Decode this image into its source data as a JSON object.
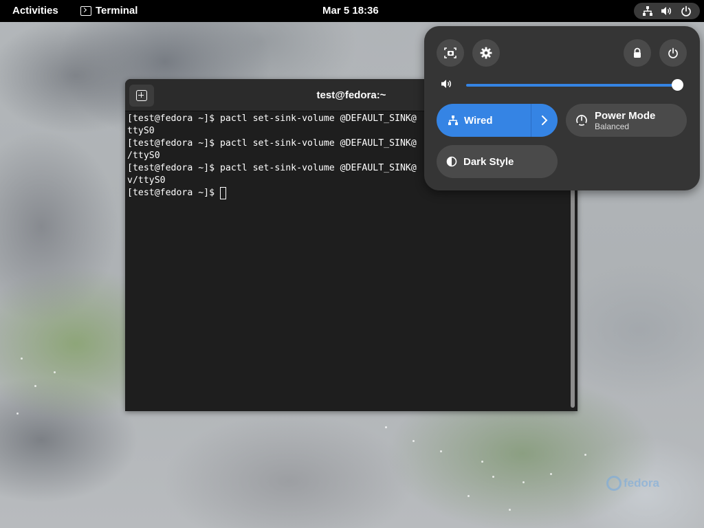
{
  "topbar": {
    "activities": "Activities",
    "app_name": "Terminal",
    "clock": "Mar 5  18:36",
    "tray_icons": [
      "network-wired-icon",
      "volume-icon",
      "power-icon"
    ]
  },
  "terminal": {
    "title": "test@fedora:~",
    "lines": [
      "[test@fedora ~]$ pactl set-sink-volume @DEFAULT_SINK@",
      "ttyS0",
      "[test@fedora ~]$ pactl set-sink-volume @DEFAULT_SINK@",
      "/ttyS0",
      "[test@fedora ~]$ pactl set-sink-volume @DEFAULT_SINK@",
      "v/ttyS0"
    ],
    "prompt": "[test@fedora ~]$ "
  },
  "quick_settings": {
    "volume_level": 1.0,
    "wired_label": "Wired",
    "power_mode_label": "Power Mode",
    "power_mode_value": "Balanced",
    "dark_style_label": "Dark Style",
    "accent_color": "#3584e4"
  },
  "watermark": "fedora"
}
